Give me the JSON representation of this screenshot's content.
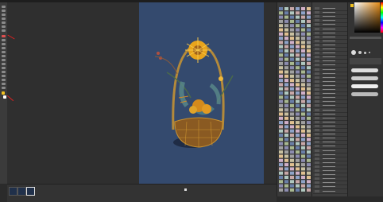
{
  "callouts": {
    "toolbar_pen_label": "",
    "toolbar_color_label": "",
    "bottom_thumbnail_label": "",
    "layer_panel_label": ""
  },
  "panels": {
    "swatch_title": "",
    "layer_title": ""
  },
  "colors": {
    "canvas_bg": "#344a6e",
    "accent_flower": "#e8a41c",
    "callout": "#e02020"
  },
  "icons": [
    "pen-icon",
    "eraser-icon",
    "color-icon",
    "move-icon",
    "hand-icon"
  ]
}
